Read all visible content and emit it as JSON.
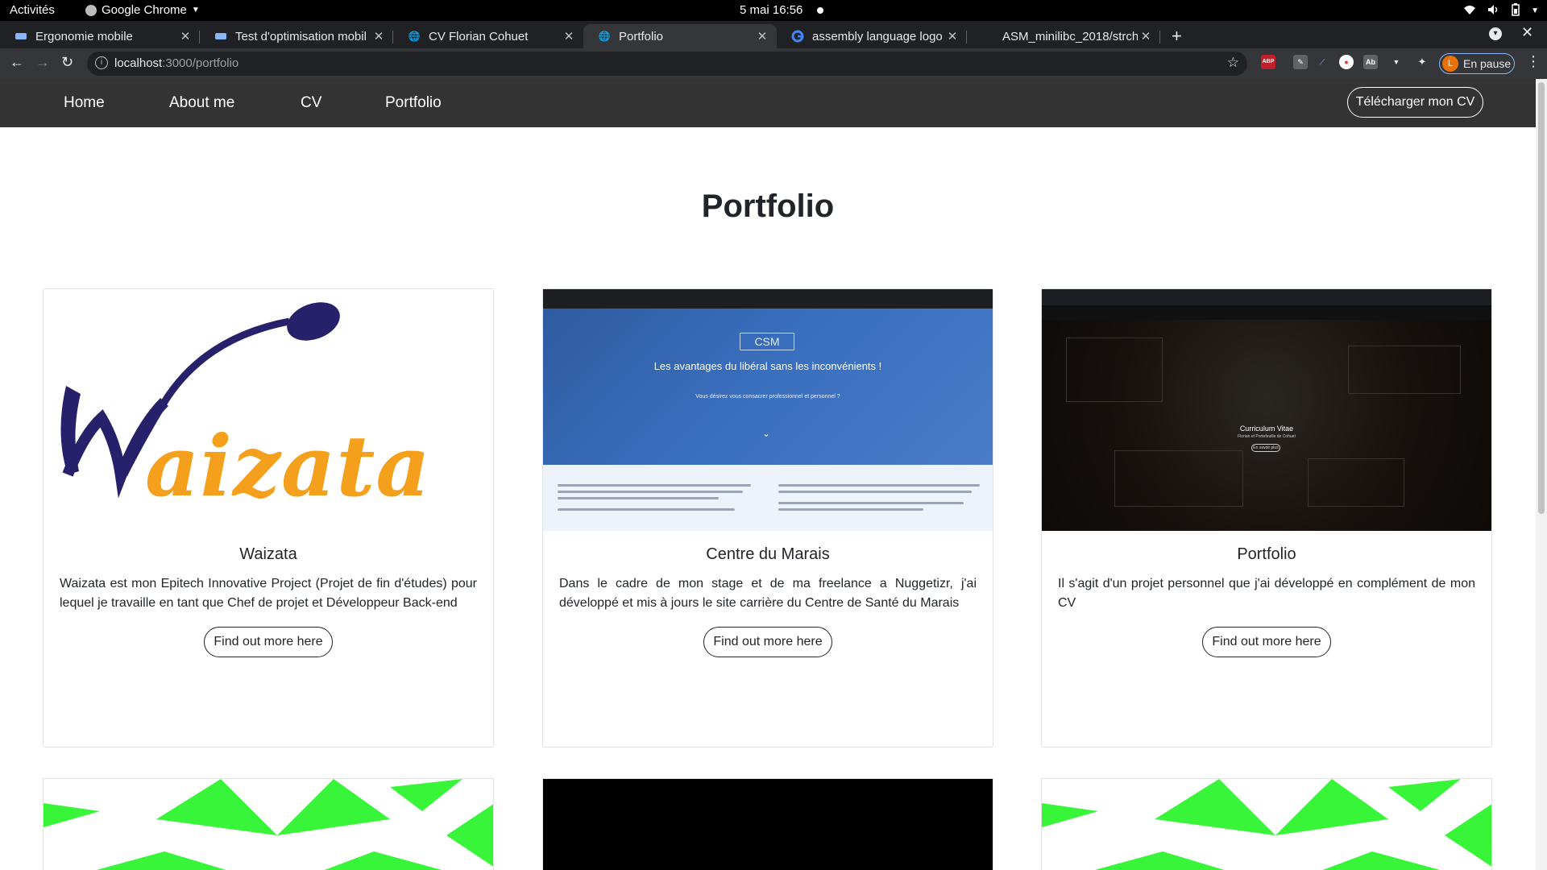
{
  "system": {
    "activities": "Activités",
    "app_name": "Google Chrome",
    "clock": "5 mai  16:56"
  },
  "tabs": [
    {
      "title": "Ergonomie mobile",
      "icon": "site-icon"
    },
    {
      "title": "Test d'optimisation mobil",
      "icon": "site-icon"
    },
    {
      "title": "CV Florian Cohuet",
      "icon": "globe-icon"
    },
    {
      "title": "Portfolio",
      "icon": "globe-icon",
      "active": true
    },
    {
      "title": "assembly language logo p",
      "icon": "google-icon"
    },
    {
      "title": "ASM_minilibc_2018/strch",
      "icon": "github-icon"
    }
  ],
  "toolbar": {
    "url_host": "localhost",
    "url_path": ":3000/portfolio",
    "profile_initial": "L",
    "profile_status": "En pause"
  },
  "site": {
    "nav": [
      "Home",
      "About me",
      "CV",
      "Portfolio"
    ],
    "download_cv": "Télécharger mon CV",
    "page_title": "Portfolio"
  },
  "cards": [
    {
      "title": "Waizata",
      "description": "Waizata est mon Epitech Innovative Project (Projet de fin d'études) pour lequel je travaille en tant que Chef de projet et Développeur Back-end",
      "button": "Find out more here",
      "logo_text": "Waizata"
    },
    {
      "title": "Centre du Marais",
      "description": "Dans le cadre de mon stage et de ma freelance a Nuggetizr, j'ai développé et mis à jours le site carrière du Centre de Santé du Marais",
      "button": "Find out more here",
      "thumb_logo": "CSM",
      "thumb_headline": "Les avantages du libéral sans les inconvénients !",
      "thumb_sub": "Vous désirez vous consacrer professionnel et personnel ?"
    },
    {
      "title": "Portfolio",
      "description": "Il s'agit d'un projet personnel que j'ai développé en complément de mon CV",
      "button": "Find out more here",
      "thumb_title": "Curriculum Vitae",
      "thumb_sub": "Florian et Portefeuille de Cohuet",
      "thumb_btn": "En savoir plus"
    }
  ],
  "colors": {
    "nav_bg": "#333333",
    "waizata_purple": "#27216b",
    "waizata_orange": "#f5a01c",
    "pattern_green": "#39f53a"
  }
}
